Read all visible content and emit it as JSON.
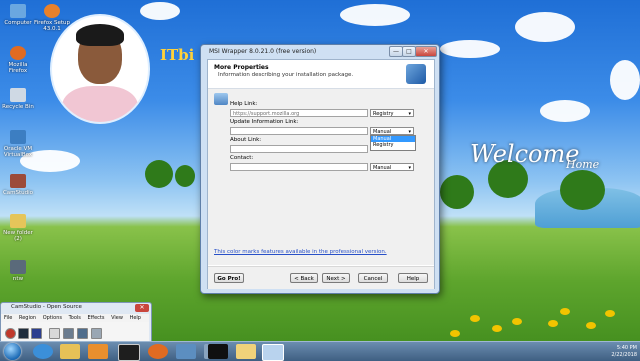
{
  "desktop": {
    "icons": [
      {
        "label": "Computer",
        "color": "#6aa7e0"
      },
      {
        "label": "Firefox Setup 43.0.1",
        "color": "#e9812a"
      },
      {
        "label": "Mozilla Firefox",
        "color": "#e06b22"
      },
      {
        "label": "Recycle Bin",
        "color": "#cfd9e4"
      },
      {
        "label": "Oracle VM VirtualBox",
        "color": "#3c7ec2"
      },
      {
        "label": "CamStudio",
        "color": "#9c4b3a"
      },
      {
        "label": "New folder (2)",
        "color": "#e5c55a"
      },
      {
        "label": "ntw",
        "color": "#5a6a7a"
      }
    ],
    "branding_text": "ITbi",
    "welcome_text": "Welcome",
    "welcome_sub": "Home"
  },
  "wizard": {
    "title": "MSI Wrapper 8.0.21.0 (free version)",
    "header_title": "More Properties",
    "header_subtitle": "Information describing your installation package.",
    "fields": {
      "help_link_label": "Help Link:",
      "help_link_placeholder": "https://support.mozilla.org",
      "help_link_mode": "Registry",
      "update_info_label": "Update Information Link:",
      "update_info_mode": "Manual",
      "about_link_label": "About Link:",
      "contact_label": "Contact:",
      "contact_mode": "Manual"
    },
    "dropdown_options": [
      "Manual",
      "Registry"
    ],
    "pro_note": "This color marks features available in the professional version.",
    "buttons": {
      "gopro": "Go Pro!",
      "back": "< Back",
      "next": "Next >",
      "cancel": "Cancel",
      "help": "Help"
    },
    "window_buttons": {
      "minimize": "—",
      "maximize": "□",
      "close": "✕"
    }
  },
  "camstudio": {
    "title": "CamStudio - Open Source",
    "menu": [
      "File",
      "Region",
      "Options",
      "Tools",
      "Effects",
      "View",
      "Help"
    ],
    "close": "✕"
  },
  "taskbar": {
    "time": "5:40 PM",
    "date": "2/22/2018",
    "apps": [
      "ie-icon",
      "folder-icon",
      "media-player-icon",
      "image-viewer-icon",
      "window-icon",
      "firefox-icon",
      "remote-desktop-icon",
      "network-icon",
      "terminal-icon",
      "explorer-icon",
      "msi-wrapper-icon"
    ]
  }
}
